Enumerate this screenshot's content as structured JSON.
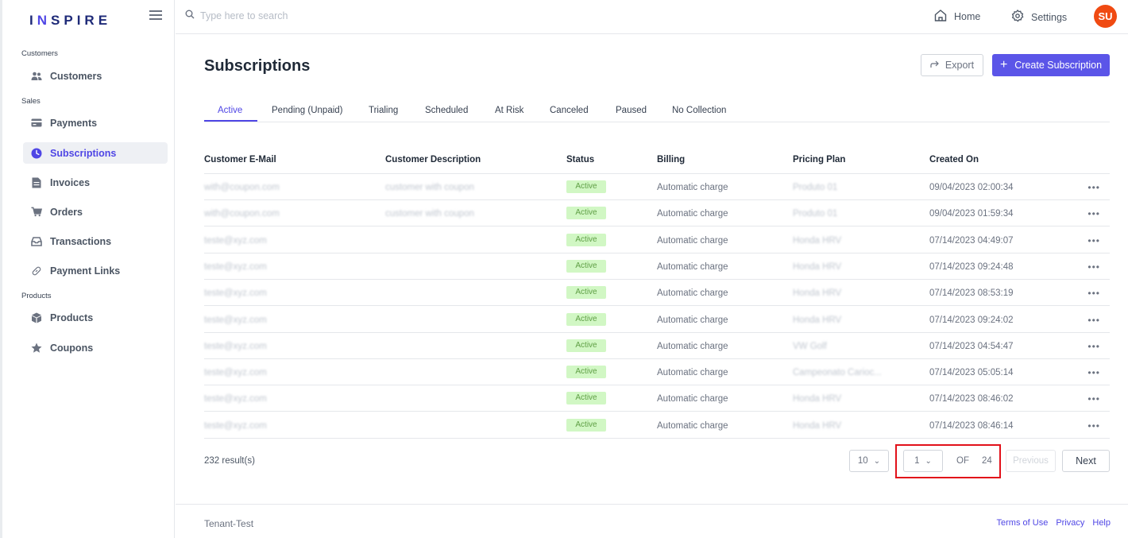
{
  "brand": {
    "name_start": "I",
    "name_accent": "N",
    "name_end": "SPIRE"
  },
  "sidebar": {
    "sections": {
      "customers": "Customers",
      "sales": "Sales",
      "products": "Products"
    },
    "items": [
      {
        "label": "Customers",
        "icon": "users-icon"
      },
      {
        "label": "Payments",
        "icon": "credit-card-icon"
      },
      {
        "label": "Subscriptions",
        "icon": "clock-icon",
        "active": true
      },
      {
        "label": "Invoices",
        "icon": "file-icon"
      },
      {
        "label": "Orders",
        "icon": "cart-icon"
      },
      {
        "label": "Transactions",
        "icon": "inbox-icon"
      },
      {
        "label": "Payment Links",
        "icon": "link-icon"
      },
      {
        "label": "Products",
        "icon": "box-icon"
      },
      {
        "label": "Coupons",
        "icon": "star-icon"
      }
    ]
  },
  "topbar": {
    "search_placeholder": "Type here to search",
    "home_label": "Home",
    "settings_label": "Settings",
    "avatar_initials": "SU"
  },
  "main": {
    "title": "Subscriptions",
    "export_label": "Export",
    "create_label": "Create Subscription",
    "tabs": [
      "Active",
      "Pending (Unpaid)",
      "Trialing",
      "Scheduled",
      "At Risk",
      "Canceled",
      "Paused",
      "No Collection"
    ],
    "active_tab": 0,
    "columns": [
      "Customer E-Mail",
      "Customer Description",
      "Status",
      "Billing",
      "Pricing Plan",
      "Created On"
    ],
    "rows": [
      {
        "email": "with@coupon.com",
        "description": "customer with coupon",
        "status": "Active",
        "billing": "Automatic charge",
        "plan": "Produto 01",
        "created": "09/04/2023 02:00:34"
      },
      {
        "email": "with@coupon.com",
        "description": "customer with coupon",
        "status": "Active",
        "billing": "Automatic charge",
        "plan": "Produto 01",
        "created": "09/04/2023 01:59:34"
      },
      {
        "email": "teste@xyz.com",
        "description": "",
        "status": "Active",
        "billing": "Automatic charge",
        "plan": "Honda HRV",
        "created": "07/14/2023 04:49:07"
      },
      {
        "email": "teste@xyz.com",
        "description": "",
        "status": "Active",
        "billing": "Automatic charge",
        "plan": "Honda HRV",
        "created": "07/14/2023 09:24:48"
      },
      {
        "email": "teste@xyz.com",
        "description": "",
        "status": "Active",
        "billing": "Automatic charge",
        "plan": "Honda HRV",
        "created": "07/14/2023 08:53:19"
      },
      {
        "email": "teste@xyz.com",
        "description": "",
        "status": "Active",
        "billing": "Automatic charge",
        "plan": "Honda HRV",
        "created": "07/14/2023 09:24:02"
      },
      {
        "email": "teste@xyz.com",
        "description": "",
        "status": "Active",
        "billing": "Automatic charge",
        "plan": "VW Golf",
        "created": "07/14/2023 04:54:47"
      },
      {
        "email": "teste@xyz.com",
        "description": "",
        "status": "Active",
        "billing": "Automatic charge",
        "plan": "Campeonato Carioc...",
        "created": "07/14/2023 05:05:14"
      },
      {
        "email": "teste@xyz.com",
        "description": "",
        "status": "Active",
        "billing": "Automatic charge",
        "plan": "Honda HRV",
        "created": "07/14/2023 08:46:02"
      },
      {
        "email": "teste@xyz.com",
        "description": "",
        "status": "Active",
        "billing": "Automatic charge",
        "plan": "Honda HRV",
        "created": "07/14/2023 08:46:14"
      }
    ],
    "row_actions": "•••",
    "results_text": "232 result(s)",
    "page_size": "10",
    "current_page": "1",
    "of_label": "OF",
    "total_pages": "24",
    "previous_label": "Previous",
    "next_label": "Next"
  },
  "footer": {
    "tenant": "Tenant-Test",
    "links": [
      "Terms of Use",
      "Privacy",
      "Help"
    ]
  },
  "colors": {
    "accent": "#4f46e5",
    "primary_button": "#5b55e8",
    "avatar": "#f04a12",
    "active_badge_bg": "#d1f7c4",
    "highlight_box": "#e2111a"
  }
}
